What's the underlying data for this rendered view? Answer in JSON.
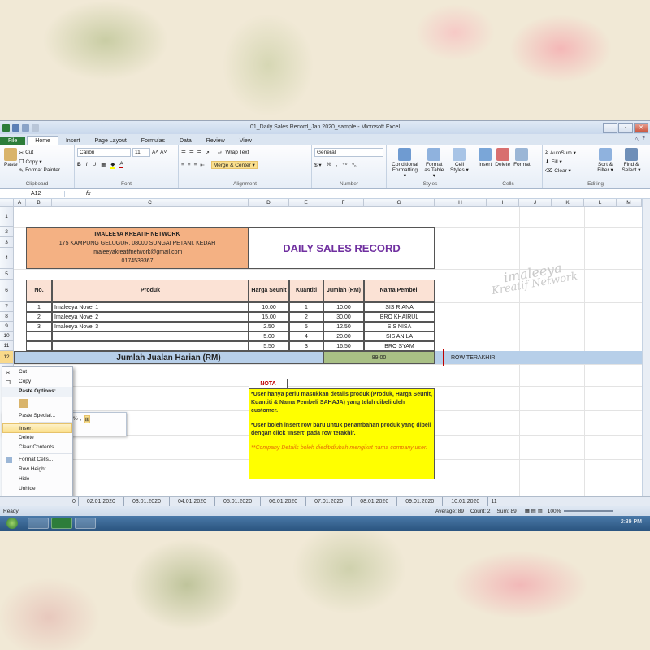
{
  "window": {
    "title": "01_Daily Sales Record_Jan 2020_sample  -  Microsoft Excel",
    "controls": [
      "–",
      "▫",
      "✕"
    ]
  },
  "ribbon_tabs": [
    "File",
    "Home",
    "Insert",
    "Page Layout",
    "Formulas",
    "Data",
    "Review",
    "View"
  ],
  "ribbon": {
    "clipboard": {
      "paste": "Paste",
      "cut": "Cut",
      "copy": "Copy ▾",
      "format_painter": "Format Painter",
      "label": "Clipboard"
    },
    "font": {
      "name": "Calibri",
      "size": "11",
      "label": "Font",
      "bold": "B",
      "italic": "I",
      "underline": "U"
    },
    "alignment": {
      "wrap": "Wrap Text",
      "merge": "Merge & Center ▾",
      "label": "Alignment"
    },
    "number": {
      "format": "General",
      "currency": "$ ▾",
      "percent": "%",
      "comma": ",",
      "label": "Number"
    },
    "styles": {
      "conditional": "Conditional Formatting ▾",
      "format_table": "Format as Table ▾",
      "cell_styles": "Cell Styles ▾",
      "label": "Styles"
    },
    "cells": {
      "insert": "Insert",
      "delete": "Delete",
      "format": "Format",
      "label": "Cells"
    },
    "editing": {
      "autosum": "AutoSum ▾",
      "fill": "Fill ▾",
      "clear": "Clear ▾",
      "sort": "Sort & Filter ▾",
      "find": "Find & Select ▾",
      "label": "Editing"
    }
  },
  "formula_bar": {
    "name_box": "A12",
    "fx": "fx",
    "content": ""
  },
  "columns": [
    "A",
    "B",
    "C",
    "D",
    "E",
    "F",
    "G",
    "H",
    "I",
    "J",
    "K",
    "L",
    "M"
  ],
  "rows": [
    "1",
    "2",
    "3",
    "4",
    "5",
    "6",
    "7",
    "8",
    "9",
    "10",
    "11",
    "12"
  ],
  "company": {
    "name": "IMALEEYA KREATIF NETWORK",
    "address": "175 KAMPUNG GELUGUR, 08000 SUNGAI PETANI, KEDAH",
    "email": "imaleeyakreatifnetwork@gmail.com",
    "phone": "0174539367"
  },
  "report_title": "DAILY SALES RECORD",
  "table": {
    "headers": [
      "No.",
      "Produk",
      "Harga Seunit",
      "Kuantiti",
      "Jumlah (RM)",
      "Nama Pembeli"
    ],
    "rows": [
      [
        "1",
        "Imaleeya Novel 1",
        "10.00",
        "1",
        "10.00",
        "SIS RIANA"
      ],
      [
        "2",
        "Imaleeya Novel 2",
        "15.00",
        "2",
        "30.00",
        "BRO KHAIRUL"
      ],
      [
        "3",
        "Imaleeya Novel 3",
        "2.50",
        "5",
        "12.50",
        "SIS NISA"
      ],
      [
        "",
        "",
        "5.00",
        "4",
        "20.00",
        "SIS ANILA"
      ],
      [
        "",
        "",
        "5.50",
        "3",
        "16.50",
        "BRO SYAM"
      ]
    ],
    "total_label": "Jumlah Jualan Harian (RM)",
    "total_value": "89.00",
    "last_row_note": "ROW TERAKHIR"
  },
  "nota": {
    "header": "NOTA",
    "p1": "*User hanya perlu masukkan details produk (Produk, Harga Seunit, Kuantiti & Nama Pembeli SAHAJA) yang telah dibeli oleh customer.",
    "p2": "*User boleh insert row baru untuk penambahan produk yang dibeli dengan click 'Insert' pada row terakhir.",
    "p3": "**Company Details boleh diedit/diubah mengikut nama company user."
  },
  "watermark": {
    "line1": "imaleeya",
    "line2": "Kreatif Network"
  },
  "mini_toolbar": {
    "font": "Calibri",
    "size": "11",
    "bold": "B",
    "italic": "I"
  },
  "context_menu": {
    "items": [
      "Cut",
      "Copy",
      "Paste Options:",
      "Paste Special...",
      "Insert",
      "Delete",
      "Clear Contents",
      "Format Cells...",
      "Row Height...",
      "Hide",
      "Unhide"
    ]
  },
  "sheet_tabs": [
    "0",
    "02.01.2020",
    "03.01.2020",
    "04.01.2020",
    "05.01.2020",
    "06.01.2020",
    "07.01.2020",
    "08.01.2020",
    "09.01.2020",
    "10.01.2020",
    "11"
  ],
  "status": {
    "ready": "Ready",
    "average": "Average: 89",
    "count": "Count: 2",
    "sum": "Sum: 89",
    "zoom": "100%"
  },
  "taskbar": {
    "clock": "2:39 PM"
  },
  "colors": {
    "company_fill": "#f4b183",
    "header_fill": "#fbe2d5",
    "total_fill": "#b7cfe9",
    "total_value_fill": "#a9c085",
    "nota_fill": "#ffff00",
    "title_color": "#7030a0",
    "file_tab": "#2d7d3a"
  }
}
